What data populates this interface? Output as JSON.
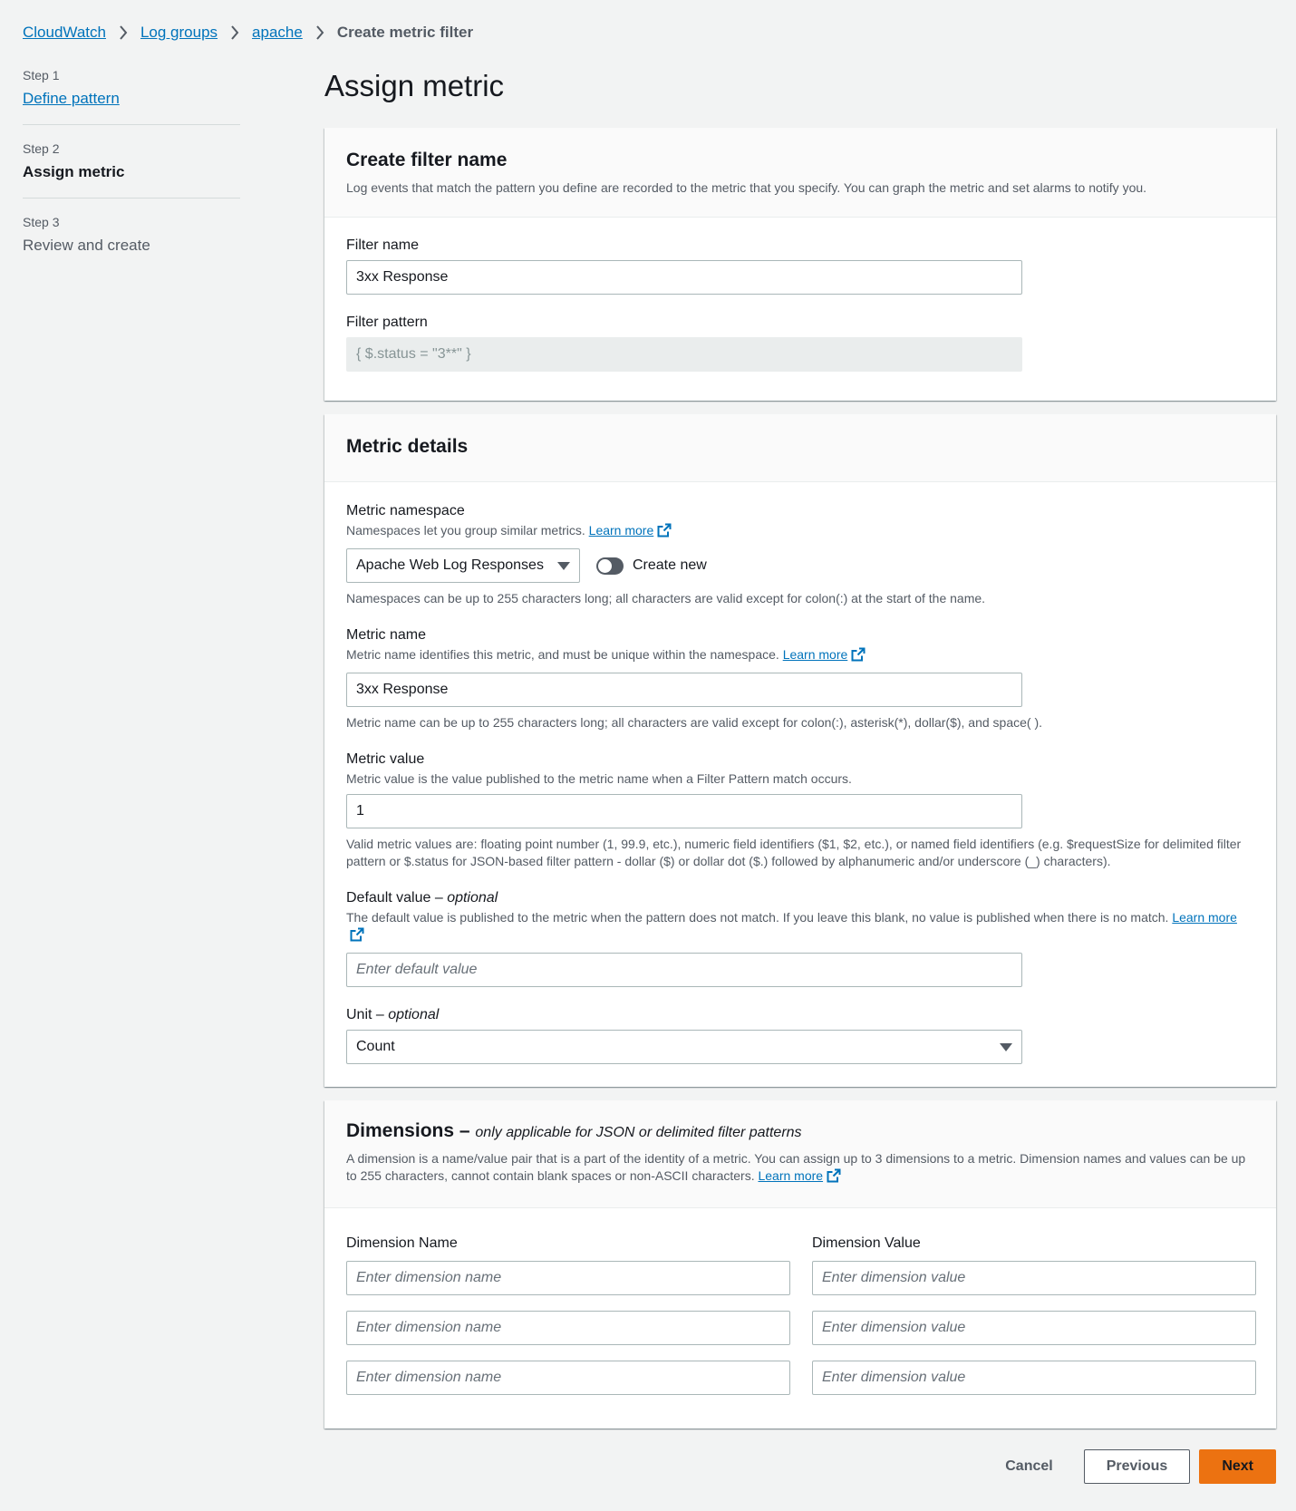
{
  "breadcrumb": {
    "items": [
      "CloudWatch",
      "Log groups",
      "apache"
    ],
    "current": "Create metric filter"
  },
  "steps": [
    {
      "num": "Step 1",
      "title": "Define pattern"
    },
    {
      "num": "Step 2",
      "title": "Assign metric"
    },
    {
      "num": "Step 3",
      "title": "Review and create"
    }
  ],
  "page_title": "Assign metric",
  "filter_panel": {
    "title": "Create filter name",
    "description": "Log events that match the pattern you define are recorded to the metric that you specify. You can graph the metric and set alarms to notify you.",
    "filter_name_label": "Filter name",
    "filter_name_value": "3xx Response",
    "filter_pattern_label": "Filter pattern",
    "filter_pattern_value": "{ $.status = \"3**\" }"
  },
  "metric_panel": {
    "title": "Metric details",
    "namespace_label": "Metric namespace",
    "namespace_desc": "Namespaces let you group similar metrics.",
    "learn_more": "Learn more",
    "namespace_value": "Apache Web Log Responses",
    "create_new_label": "Create new",
    "namespace_constraint": "Namespaces can be up to 255 characters long; all characters are valid except for colon(:) at the start of the name.",
    "metric_name_label": "Metric name",
    "metric_name_desc": "Metric name identifies this metric, and must be unique within the namespace.",
    "metric_name_value": "3xx Response",
    "metric_name_constraint": "Metric name can be up to 255 characters long; all characters are valid except for colon(:), asterisk(*), dollar($), and space( ).",
    "metric_value_label": "Metric value",
    "metric_value_desc": "Metric value is the value published to the metric name when a Filter Pattern match occurs.",
    "metric_value_value": "1",
    "metric_value_constraint": "Valid metric values are: floating point number (1, 99.9, etc.), numeric field identifiers ($1, $2, etc.), or named field identifiers (e.g. $requestSize for delimited filter pattern or $.status for JSON-based filter pattern - dollar ($) or dollar dot ($.) followed by alphanumeric and/or underscore (_) characters).",
    "default_value_label": "Default value",
    "optional": "optional",
    "default_value_desc": "The default value is published to the metric when the pattern does not match. If you leave this blank, no value is published when there is no match.",
    "default_value_placeholder": "Enter default value",
    "unit_label": "Unit",
    "unit_value": "Count"
  },
  "dimensions_panel": {
    "title": "Dimensions",
    "title_suffix": "only applicable for JSON or delimited filter patterns",
    "description": "A dimension is a name/value pair that is a part of the identity of a metric. You can assign up to 3 dimensions to a metric. Dimension names and values can be up to 255 characters, cannot contain blank spaces or non-ASCII characters.",
    "name_col_label": "Dimension Name",
    "value_col_label": "Dimension Value",
    "name_placeholder": "Enter dimension name",
    "value_placeholder": "Enter dimension value"
  },
  "footer": {
    "cancel": "Cancel",
    "previous": "Previous",
    "next": "Next"
  },
  "colors": {
    "link": "#0073bb",
    "primary_button": "#ec7211",
    "background": "#f2f3f3"
  }
}
